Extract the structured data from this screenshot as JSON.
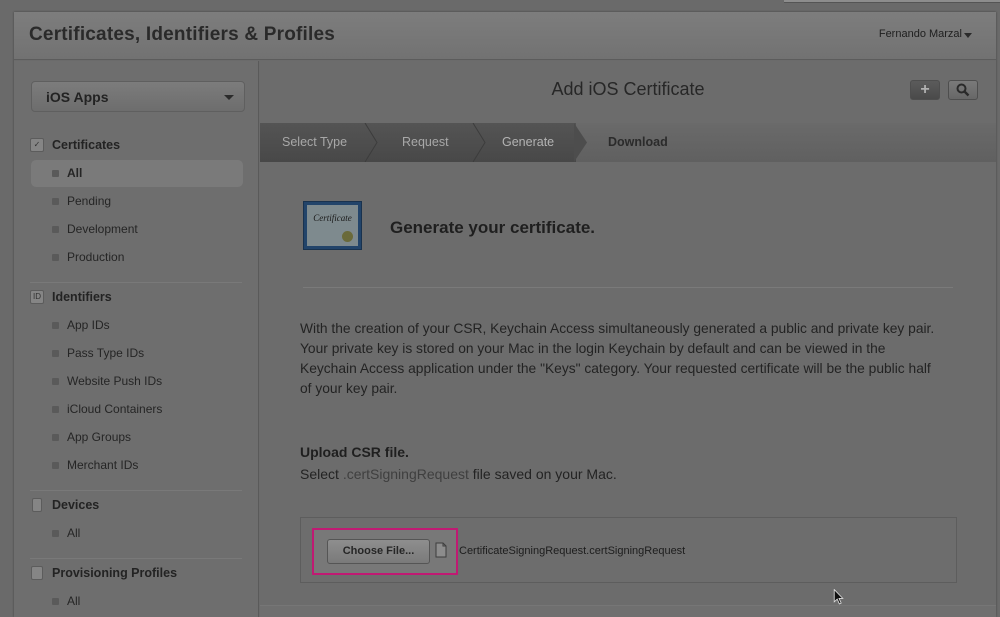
{
  "header": {
    "title": "Certificates, Identifiers & Profiles",
    "user_name": "Fernando Marzal"
  },
  "sidebar": {
    "platform_select": "iOS Apps",
    "sections": [
      {
        "title": "Certificates",
        "icon": "certificate-check-icon",
        "items": [
          "All",
          "Pending",
          "Development",
          "Production"
        ],
        "active_index": 0
      },
      {
        "title": "Identifiers",
        "icon": "id-badge-icon",
        "items": [
          "App IDs",
          "Pass Type IDs",
          "Website Push IDs",
          "iCloud Containers",
          "App Groups",
          "Merchant IDs"
        ]
      },
      {
        "title": "Devices",
        "icon": "iphone-device-icon",
        "items": [
          "All"
        ]
      },
      {
        "title": "Provisioning Profiles",
        "icon": "document-icon",
        "items": [
          "All"
        ]
      }
    ]
  },
  "main": {
    "title": "Add iOS Certificate",
    "toolbar": {
      "add_icon": "plus-icon",
      "search_icon": "magnifier-icon"
    },
    "steps": [
      "Select Type",
      "Request",
      "Generate",
      "Download"
    ],
    "current_step": 2,
    "generate_title": "Generate your certificate.",
    "paragraph": "With the creation of your CSR, Keychain Access simultaneously generated a public and private key pair. Your private key is stored on your Mac in the login Keychain by default and can be viewed in the Keychain Access application under the \"Keys\" category. Your requested certificate will be the public half of your key pair.",
    "upload": {
      "title": "Upload CSR file.",
      "desc_prefix": "Select",
      "desc_ext": ".certSigningRequest",
      "desc_suffix": "file saved on your Mac.",
      "button_label": "Choose File...",
      "file_name": "CertificateSigningRequest.certSigningRequest"
    },
    "cert_icon_text": "Certificate"
  },
  "colors": {
    "highlight_border": "#c01a73",
    "cert_icon_bg": "#22446a"
  }
}
